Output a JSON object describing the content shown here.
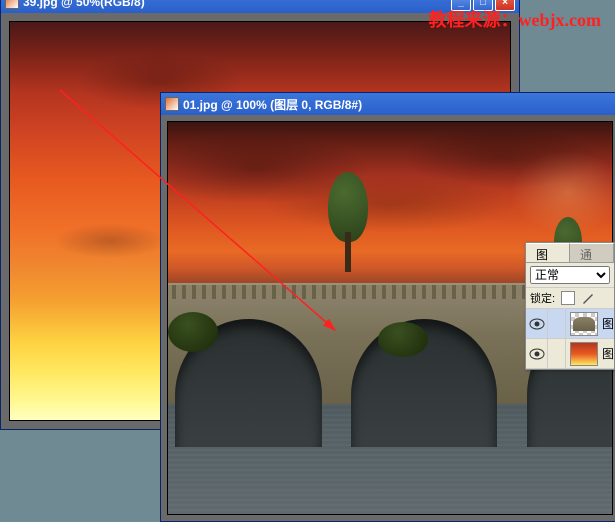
{
  "watermark": {
    "text": "教程来源：webjx.com",
    "label_color": "#ff2020"
  },
  "window1": {
    "title": "39.jpg @ 50%(RGB/8)"
  },
  "window2": {
    "title": "01.jpg @ 100% (图层 0, RGB/8#)"
  },
  "panel": {
    "tab_layers": "图层",
    "tab_channels": "通道",
    "blend_mode": "正常",
    "lock_label": "锁定:",
    "layer1_name": "图",
    "layer0_name": "图"
  }
}
